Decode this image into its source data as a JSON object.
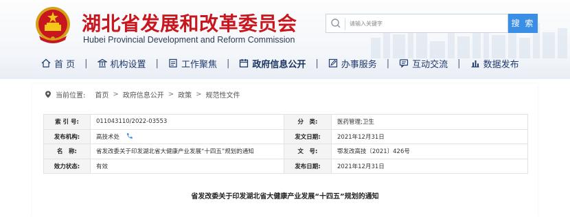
{
  "header": {
    "title": "湖北省发展和改革委员会",
    "subtitle": "Hubei Provincial Development and Reform Commission",
    "emblem_icon": "national-emblem-icon"
  },
  "search": {
    "placeholder": "请输入关键字",
    "button_label": "搜 索"
  },
  "nav": {
    "items": [
      {
        "label": "首 页",
        "icon": "home-icon"
      },
      {
        "label": "机构设置",
        "icon": "institution-icon"
      },
      {
        "label": "工作聚焦",
        "icon": "document-icon"
      },
      {
        "label": "政府信息公开",
        "icon": "calendar-icon",
        "active": true
      },
      {
        "label": "办事服务",
        "icon": "edit-icon"
      },
      {
        "label": "互动交流",
        "icon": "chat-icon"
      },
      {
        "label": "数据发布",
        "icon": "bar-chart-icon"
      }
    ],
    "separator": "|"
  },
  "breadcrumb": {
    "prefix": "当前位置:",
    "items": [
      "首页",
      "政府信息公开",
      "政策",
      "规范性文件"
    ],
    "separator": ">"
  },
  "meta": {
    "index_label": "索 引 号:",
    "index_value": "011043110/2022-03553",
    "category_label": "分　类:",
    "category_value": "医药管理;卫生",
    "issuer_label": "发布机构:",
    "issuer_value": "高技术处",
    "issue_date_label": "发文日期:",
    "issue_date_value": "2021年12月31日",
    "name_label": "名　称:",
    "name_value": "省发改委关于印发湖北省大健康产业发展“十四五”规划的通知",
    "docno_label": "文　号:",
    "docno_value": "鄂发改高技〔2021〕426号",
    "status_label": "效力状态:",
    "status_value": "有效",
    "publish_date_label": "发布日期:",
    "publish_date_value": "2021年12月31日"
  },
  "document": {
    "title": "省发改委关于印发湖北省大健康产业发展“十四五”规划的通知"
  },
  "colors": {
    "title_red": "#c8161e",
    "search_blue": "#3a8ee6",
    "nav_blue": "#1f3a6e"
  }
}
